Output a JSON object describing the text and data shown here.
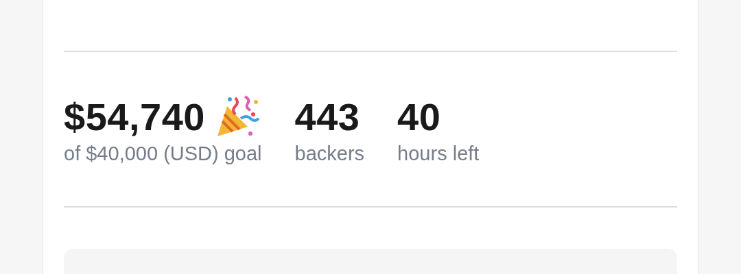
{
  "stats": [
    {
      "value": "$54,740",
      "label": "of $40,000 (USD) goal",
      "celebrate": true
    },
    {
      "value": "443",
      "label": "backers",
      "celebrate": false
    },
    {
      "value": "40",
      "label": "hours left",
      "celebrate": false
    }
  ]
}
